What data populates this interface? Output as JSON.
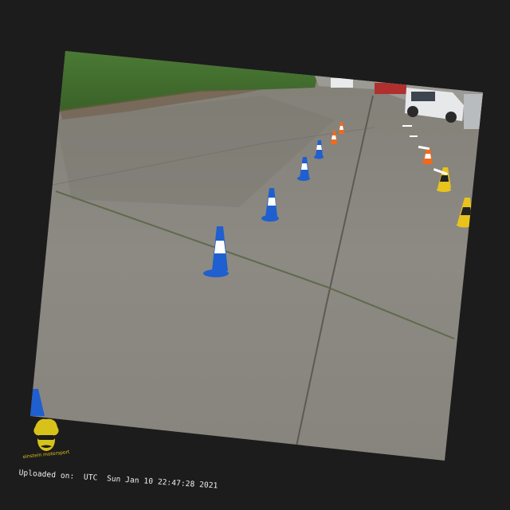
{
  "photo": {
    "subject": "outdoor cone slalom course on concrete pavement",
    "cone_colors": {
      "blue": "#1f5fcf",
      "orange": "#f06a1e",
      "yellow": "#e8c31d",
      "white": "#ffffff"
    },
    "pavement_color": "#8a877f",
    "hedge_color": "#4f7a38",
    "car_color": "#e6e8ea"
  },
  "watermark": {
    "logo_text": "einstein motorsport",
    "logo_color": "#d8c21a"
  },
  "upload": {
    "label": "Uploaded on:",
    "timezone": "UTC",
    "datetime": "Sun Jan 10 22:47:28 2021"
  }
}
